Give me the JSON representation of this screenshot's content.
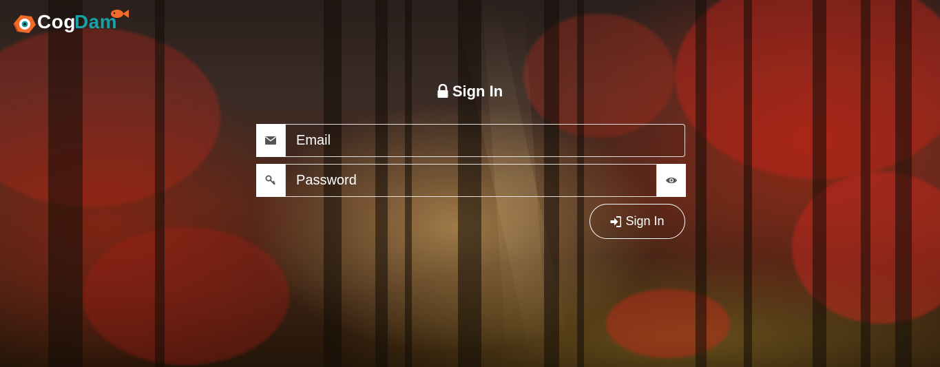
{
  "brand": {
    "part1": "Cog",
    "part2": "Dam",
    "accent": "#16a2a8",
    "orange": "#f26b2a"
  },
  "form": {
    "title": "Sign In",
    "email_placeholder": "Email",
    "password_placeholder": "Password",
    "submit_label": "Sign In"
  },
  "icons": {
    "title": "lock-icon",
    "email": "envelope-icon",
    "password": "key-icon",
    "toggle": "eye-icon",
    "submit": "sign-in-icon"
  }
}
